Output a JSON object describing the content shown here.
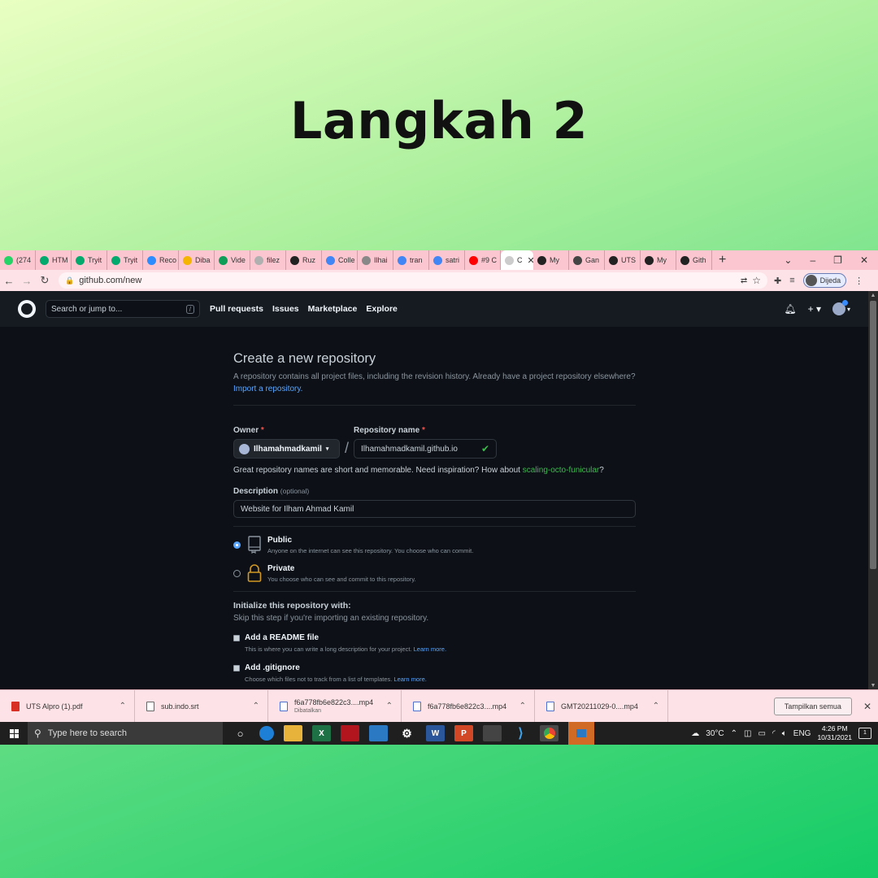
{
  "slide": {
    "title": "Langkah 2"
  },
  "browser": {
    "tabs": [
      {
        "label": "(274",
        "icon": "whatsapp-icon",
        "color": "#25d366"
      },
      {
        "label": "HTM",
        "icon": "w3schools-icon",
        "color": "#04aa6d"
      },
      {
        "label": "Tryit",
        "icon": "w3schools-icon",
        "color": "#04aa6d"
      },
      {
        "label": "Tryit",
        "icon": "w3schools-icon",
        "color": "#04aa6d"
      },
      {
        "label": "Reco",
        "icon": "zoom-icon",
        "color": "#2d8cff"
      },
      {
        "label": "Diba",
        "icon": "google-drive-icon",
        "color": "#f4b400"
      },
      {
        "label": "Vide",
        "icon": "google-drive-icon",
        "color": "#0f9d58"
      },
      {
        "label": "filez",
        "icon": "loading-icon",
        "color": "#b0b0b0"
      },
      {
        "label": "Ruz",
        "icon": "github-icon",
        "color": "#222222"
      },
      {
        "label": "Colle",
        "icon": "google-icon",
        "color": "#4285f4"
      },
      {
        "label": "Ilhai",
        "icon": "github-icon",
        "color": "#888888"
      },
      {
        "label": "tran",
        "icon": "google-icon",
        "color": "#4285f4"
      },
      {
        "label": "satri",
        "icon": "google-icon",
        "color": "#4285f4"
      },
      {
        "label": "#9 C",
        "icon": "youtube-icon",
        "color": "#ff0000"
      },
      {
        "label": "C",
        "icon": "github-icon",
        "color": "#cccccc",
        "active": true
      },
      {
        "label": "My ",
        "icon": "github-icon",
        "color": "#222222"
      },
      {
        "label": "Gan",
        "icon": "settings-icon",
        "color": "#444444"
      },
      {
        "label": "UTS",
        "icon": "github-icon",
        "color": "#222222"
      },
      {
        "label": "My",
        "icon": "github-icon",
        "color": "#222222"
      },
      {
        "label": "Gith",
        "icon": "github-icon",
        "color": "#222222"
      }
    ],
    "new_tab": "+",
    "url": "github.com/new",
    "profile_name": "Dijeda"
  },
  "github": {
    "search_placeholder": "Search or jump to...",
    "search_shortcut": "/",
    "nav": [
      "Pull requests",
      "Issues",
      "Marketplace",
      "Explore"
    ]
  },
  "form": {
    "heading": "Create a new repository",
    "subtitle": "A repository contains all project files, including the revision history. Already have a project repository elsewhere?",
    "import_link": "Import a repository.",
    "owner_label": "Owner",
    "required_mark": "*",
    "owner_value": "Ilhamahmadkamil",
    "separator": "/",
    "repo_label": "Repository name",
    "repo_value": "Ilhamahmadkamil.github.io",
    "hint_prefix": "Great repository names are short and memorable. Need inspiration? How about",
    "hint_suggestion": "scaling-octo-funicular",
    "hint_suffix": "?",
    "description_label": "Description",
    "description_optional": "(optional)",
    "description_value": "Website for Ilham Ahmad Kamil",
    "visibility": {
      "public_title": "Public",
      "public_desc": "Anyone on the internet can see this repository. You choose who can commit.",
      "private_title": "Private",
      "private_desc": "You choose who can see and commit to this repository.",
      "selected": "public"
    },
    "init_title": "Initialize this repository with:",
    "init_sub": "Skip this step if you're importing an existing repository.",
    "readme_title": "Add a README file",
    "readme_desc": "This is where you can write a long description for your project.",
    "gitignore_title": "Add .gitignore",
    "gitignore_desc": "Choose which files not to track from a list of templates.",
    "learn_more": "Learn more."
  },
  "downloads": {
    "items": [
      {
        "name": "UTS Alpro (1).pdf",
        "status": "",
        "type": "pdf"
      },
      {
        "name": "sub.indo.srt",
        "status": "",
        "type": "file"
      },
      {
        "name": "f6a778fb6e822c3....mp4",
        "status": "Dibatalkan",
        "type": "mp4"
      },
      {
        "name": "f6a778fb6e822c3....mp4",
        "status": "",
        "type": "mp4"
      },
      {
        "name": "GMT20211029-0....mp4",
        "status": "",
        "type": "mp4"
      }
    ],
    "show_all": "Tampilkan semua"
  },
  "taskbar": {
    "search_placeholder": "Type here to search",
    "weather": "30°C",
    "language": "ENG",
    "time": "4:26 PM",
    "date": "10/31/2021",
    "notifications": "1"
  }
}
